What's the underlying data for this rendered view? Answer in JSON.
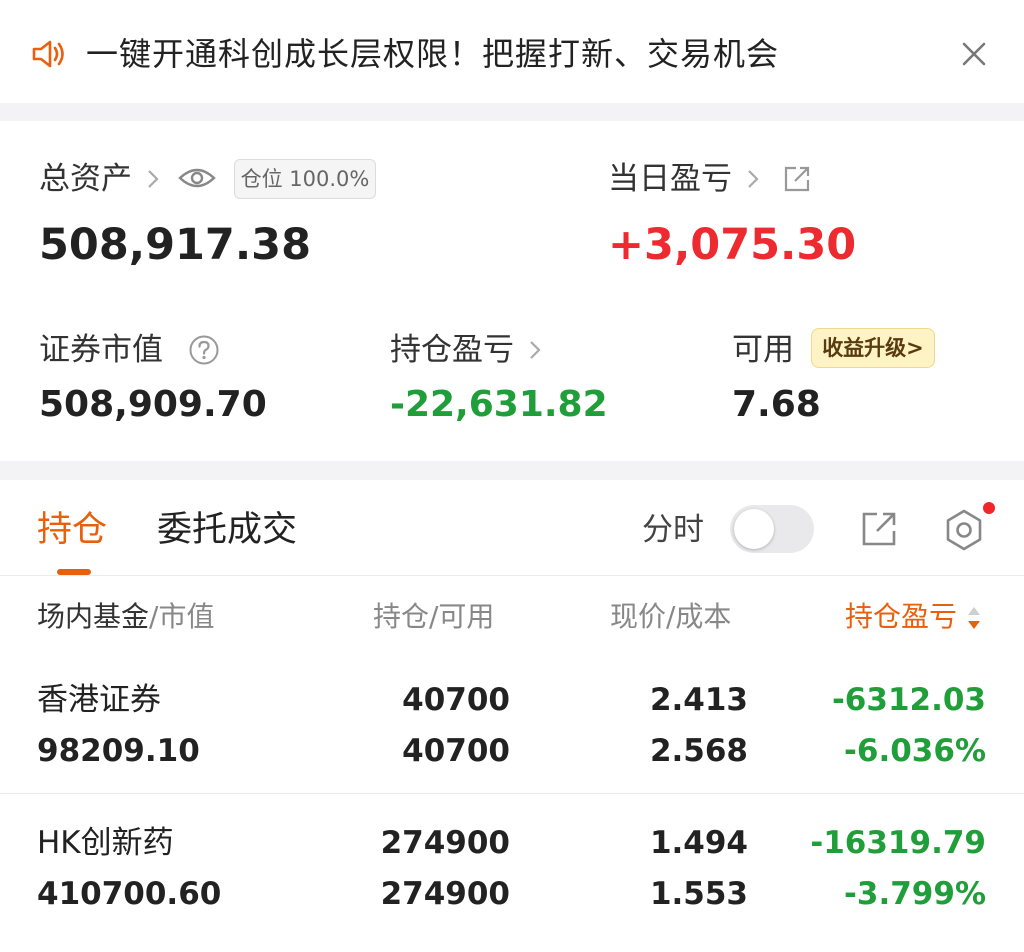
{
  "banner": {
    "text": "一键开通科创成长层权限！把握打新、交易机会",
    "speaker_icon": "speaker-icon",
    "close_icon": "close-icon",
    "accent": "#e8600d"
  },
  "summary": {
    "total_assets_label": "总资产",
    "position_badge": "仓位 100.0%",
    "total_assets_value": "508,917.38",
    "daily_pnl_label": "当日盈亏",
    "daily_pnl_value": "+3,075.30",
    "market_value_label": "证券市值",
    "market_value": "508,909.70",
    "holding_pnl_label": "持仓盈亏",
    "holding_pnl_value": "-22,631.82",
    "available_label": "可用",
    "upgrade_badge": "收益升级>",
    "available_value": "7.68"
  },
  "tabs": [
    {
      "label": "持仓",
      "active": true
    },
    {
      "label": "委托成交",
      "active": false
    }
  ],
  "toolbar": {
    "fenshi_label": "分时",
    "fenshi_on": false
  },
  "columns": {
    "c1_main": "场内基金",
    "c1_sub": "/市值",
    "c2": "持仓/可用",
    "c3": "现价/成本",
    "c4": "持仓盈亏"
  },
  "holdings": [
    {
      "name": "香港证券",
      "market_value": "98209.10",
      "position": "40700",
      "available": "40700",
      "price": "2.413",
      "cost": "2.568",
      "pnl": "-6312.03",
      "pnl_pct": "-6.036%"
    },
    {
      "name": "HK创新药",
      "market_value": "410700.60",
      "position": "274900",
      "available": "274900",
      "price": "1.494",
      "cost": "1.553",
      "pnl": "-16319.79",
      "pnl_pct": "-3.799%"
    }
  ],
  "colors": {
    "up": "#ec2a2f",
    "down": "#1f9e3a",
    "accent": "#e8600d"
  }
}
